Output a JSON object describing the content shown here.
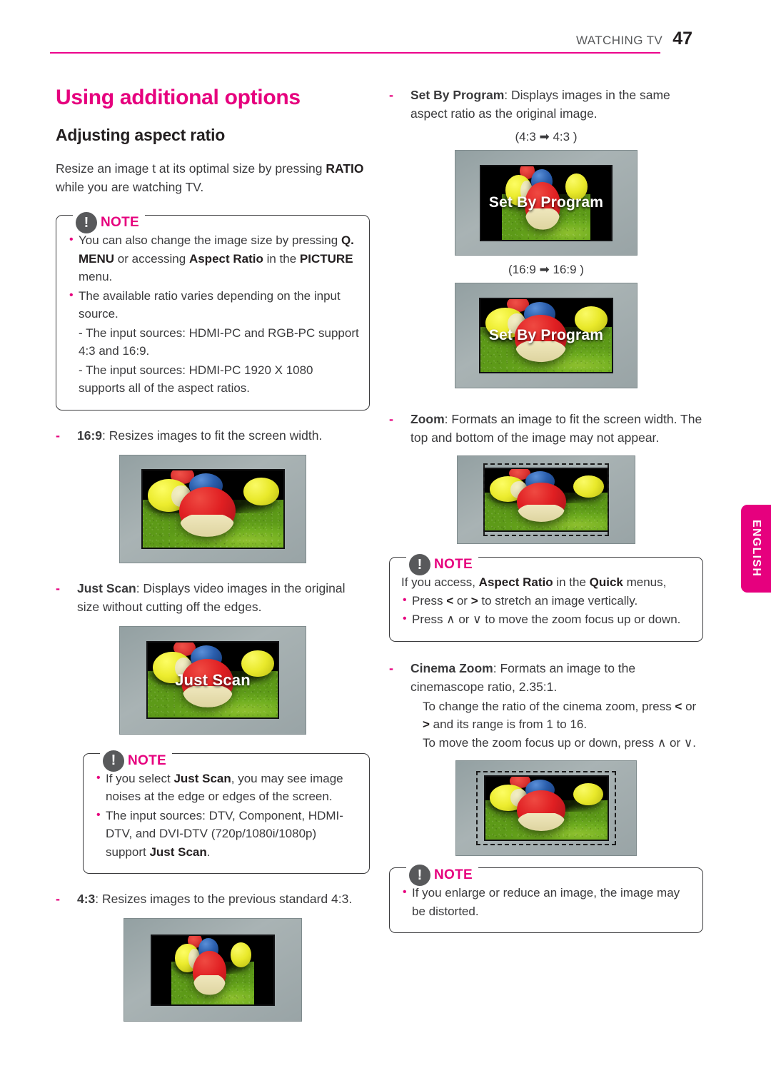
{
  "header": {
    "breadcrumb": "WATCHING TV",
    "page_number": "47",
    "accent_color": "#e6007e"
  },
  "side_tab": {
    "label": "ENGLISH"
  },
  "left_column": {
    "section_title": "Using additional options",
    "sub_title": "Adjusting aspect ratio",
    "intro_1": "Resize an image t at its optimal size by pressing ",
    "intro_bold": "RATIO",
    "intro_2": " while you are watching TV.",
    "note": {
      "label": "NOTE",
      "icon": "exclamation-icon",
      "items": [
        "You can also change the image size by pressing Q. MENU or accessing Aspect Ratio in the PICTURE menu.",
        "The available ratio varies depending on the input source.",
        "- The input sources: HDMI-PC and RGB-PC support 4:3 and 16:9.",
        "- The input sources: HDMI-PC 1920 X 1080 supports all of the aspect ratios."
      ]
    },
    "items": [
      {
        "term": "16:9",
        "desc": ": Resizes images to fit the screen width.",
        "figure": {
          "name": "tv-16-9",
          "overlay": "",
          "mode": "full"
        }
      },
      {
        "term": "Just Scan",
        "desc": ": Displays video images in the original size without cutting off the edges.",
        "figure": {
          "name": "tv-just-scan",
          "overlay": "Just Scan",
          "mode": "full"
        }
      },
      {
        "term": "4:3",
        "desc": ": Resizes images to the previous standard 4:3.",
        "figure": {
          "name": "tv-4-3",
          "overlay": "",
          "mode": "pillarbox"
        }
      }
    ],
    "note2": {
      "label": "NOTE",
      "icon": "exclamation-icon",
      "items": [
        "If you select Just Scan, you may see image noises at the edge or edges of the screen.",
        "The input sources: DTV, Component, HDMI-DTV, and DVI-DTV (720p/1080i/1080p) support Just Scan."
      ]
    }
  },
  "right_column": {
    "set_by_program": {
      "term": "Set By Program",
      "desc": ": Displays images in the same aspect ratio as the original image.",
      "ratio_label_1": "(4:3 ➡ 4:3 )",
      "ratio_label_2": "(16:9 ➡ 16:9 )",
      "overlay": "Set By Program"
    },
    "zoom": {
      "term": "Zoom",
      "desc": ": Formats an image to fit the screen width. The top and bottom of the image may not appear."
    },
    "note_zoom": {
      "label": "NOTE",
      "icon": "exclamation-icon",
      "intro": "If you access, Aspect Ratio in the Quick menus,",
      "items": [
        "Press < or > to stretch an image vertically.",
        "Press ∧ or ∨ to move the zoom focus up or down."
      ]
    },
    "cinema_zoom": {
      "term": "Cinema Zoom",
      "desc": ": Formats an image to the cinemascope ratio, 2.35:1.",
      "items": [
        "To change the ratio of the cinema zoom, press < or > and its range is from 1 to 16.",
        "To move the zoom focus up or down, press ∧ or ∨."
      ]
    },
    "note_final": {
      "label": "NOTE",
      "icon": "exclamation-icon",
      "items": [
        "If you enlarge or reduce an image, the image may be distorted."
      ]
    }
  }
}
